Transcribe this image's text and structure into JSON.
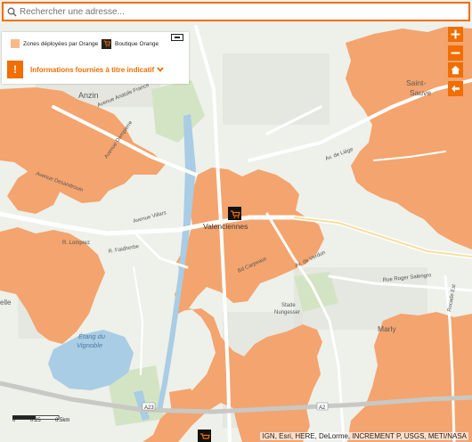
{
  "search": {
    "placeholder": "Rechercher une adresse..."
  },
  "legend": {
    "zone_label": "Zones déployées par Orange",
    "shop_label": "Boutique Orange",
    "info_label": "Informations fournies à titre indicatif",
    "warn_symbol": "!"
  },
  "map": {
    "places": {
      "anzin": "Anzin",
      "saint": "Saint-",
      "sauve": "Sauve",
      "valenciennes": "Valenciennes",
      "marly": "Marly",
      "stade1": "Stade",
      "stade2": "Nungesser",
      "etang1": "Étang du",
      "etang2": "Vignoble",
      "elle": "elle"
    },
    "roads": {
      "av_anatole": "Avenue Anatole France",
      "av_dampierre": "Avenue Dampierre",
      "av_villars": "Avenue Villars",
      "av_liege": "Av. de Liège",
      "av_desandrouin": "Avenue Desandrouin",
      "r_lomprez": "R. Lomprez",
      "r_faidherbe": "R. Faidherbe",
      "bd_carpeaux": "Bd Carpeaux",
      "av_verdun": "Av. de Verdun",
      "r_roger_salengro": "Rue Roger Salengro",
      "rocade": "Rocade Est",
      "a23": "A23",
      "a2": "A2"
    },
    "shop_marker_label": "Boutique Orange",
    "scale": {
      "zero": "0",
      "mid": "0.25",
      "end": "0.5km"
    },
    "attribution": "IGN, Esri, HERE, DeLorme, INCREMENT P, USGS, METI/NASA"
  },
  "controls": {
    "zoom_in": "+",
    "zoom_out": "−",
    "home": "home",
    "back": "back"
  },
  "colors": {
    "accent": "#f16e00",
    "zone_fill": "#f4a46e",
    "legend_swatch": "#f9b98d",
    "water": "#a8cde4",
    "land": "#eef0ea"
  }
}
